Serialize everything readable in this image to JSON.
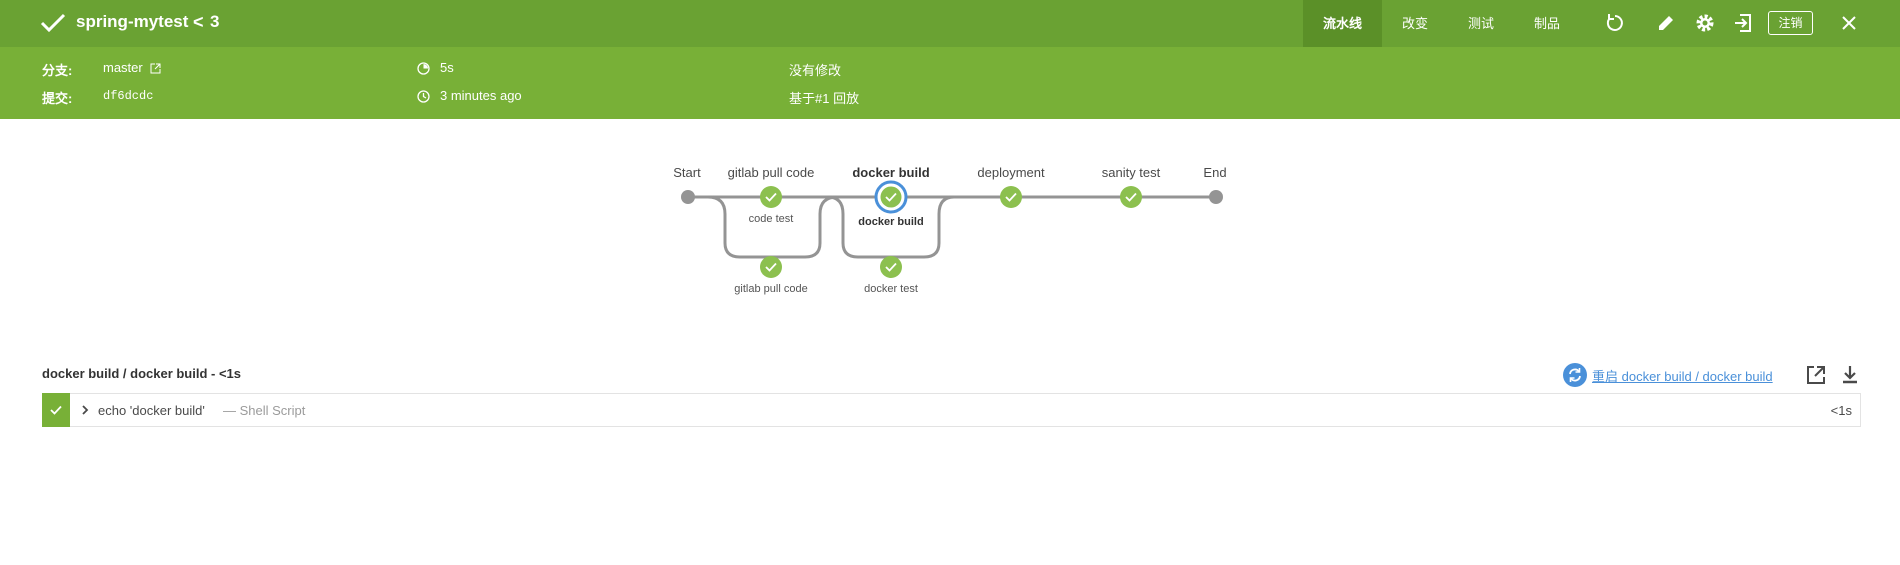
{
  "header": {
    "title": "spring-mytest",
    "run_separator": "<",
    "run_number": "3",
    "tabs": [
      {
        "label": "流水线",
        "active": true
      },
      {
        "label": "改变",
        "active": false
      },
      {
        "label": "测试",
        "active": false
      },
      {
        "label": "制品",
        "active": false
      }
    ],
    "icons": [
      "replay-icon",
      "edit-icon",
      "settings-icon",
      "exit-icon",
      "close-icon"
    ],
    "logout_label": "注销"
  },
  "meta": {
    "branch_label": "分支:",
    "branch_value": "master",
    "commit_label": "提交:",
    "commit_value": "df6dcdc",
    "duration": "5s",
    "time_ago": "3 minutes ago",
    "changes": "没有修改",
    "replay_note": "基于#1 回放"
  },
  "pipeline": {
    "stages": [
      {
        "label": "Start"
      },
      {
        "label": "gitlab pull code"
      },
      {
        "label": "docker build",
        "selected": true
      },
      {
        "label": "deployment"
      },
      {
        "label": "sanity test"
      },
      {
        "label": "End"
      }
    ],
    "parallel": [
      {
        "label": "code test"
      },
      {
        "label": "gitlab pull code"
      },
      {
        "label": "docker build",
        "selected": true
      },
      {
        "label": "docker test"
      }
    ]
  },
  "step": {
    "title": "docker build / docker build - <1s",
    "restart_label": "重启 docker build / docker build",
    "log": {
      "command": "echo 'docker build'",
      "type": "— Shell Script",
      "duration": "<1s"
    }
  },
  "colors": {
    "header": "#6aa233",
    "meta_bar": "#78b037",
    "success": "#8cc04f",
    "selected_ring": "#4a90d9",
    "track": "#949494"
  }
}
